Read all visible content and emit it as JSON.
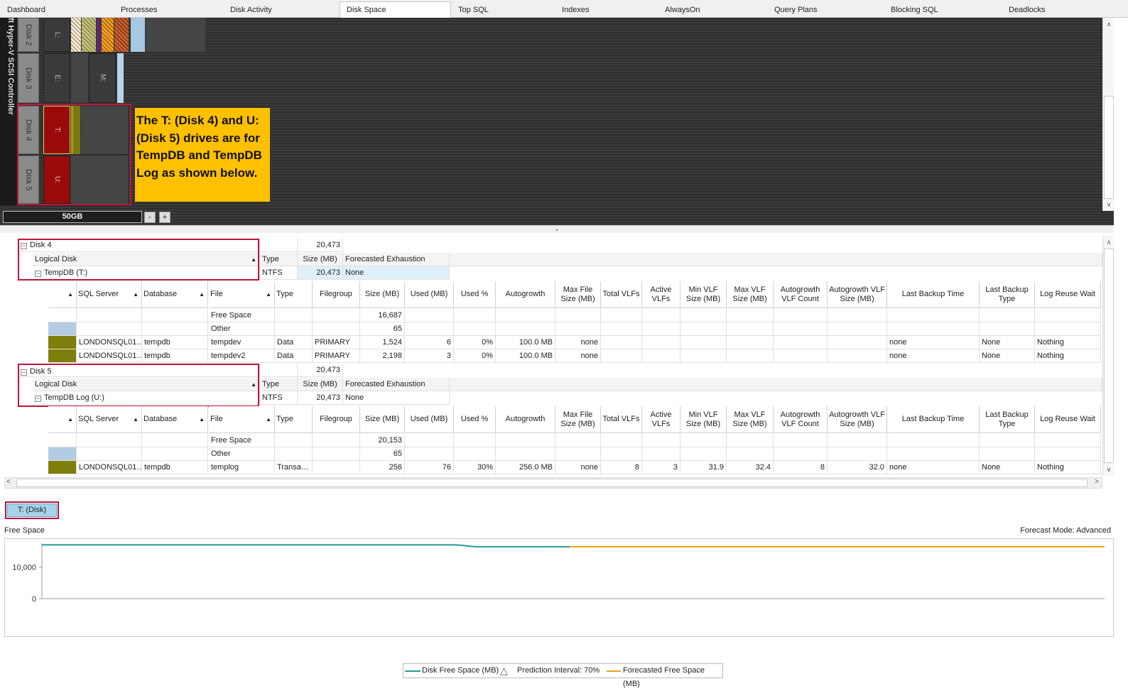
{
  "tabs": [
    "Dashboard",
    "Processes",
    "Disk Activity",
    "Disk Space",
    "Top SQL",
    "Indexes",
    "AlwaysOn",
    "Query Plans",
    "Blocking SQL",
    "Deadlocks"
  ],
  "active_tab": "Disk Space",
  "disk_map": {
    "controller_label": "ft Hyper-V SCSI Controller",
    "disks": [
      "Disk 2",
      "Disk 3",
      "Disk 4",
      "Disk 5"
    ],
    "volumes": {
      "disk2": [
        "L:"
      ],
      "disk3": [
        "E:",
        "M:"
      ],
      "disk4": [
        "T:"
      ],
      "disk5": [
        "U:"
      ]
    },
    "zoom_label": "50GB",
    "zoom_out": "-",
    "zoom_in": "+",
    "callout": "The T: (Disk 4) and U: (Disk 5) drives are for TempDB and TempDB Log as shown below."
  },
  "grid": {
    "disk_headers": [
      "Logical Disk",
      "Type",
      "Size (MB)",
      "Forecasted Exhaustion"
    ],
    "file_headers": [
      "SQL Server",
      "Database",
      "File",
      "Type",
      "Filegroup",
      "Size (MB)",
      "Used (MB)",
      "Used %",
      "Autogrowth",
      "Max File Size (MB)",
      "Total VLFs",
      "Active VLFs",
      "Min VLF Size (MB)",
      "Max VLF Size (MB)",
      "Autogrowth VLF Count",
      "Autogrowth VLF Size (MB)",
      "Last Backup Time",
      "Last Backup Type",
      "Log Reuse Wait"
    ],
    "disk4": {
      "name": "Disk 4",
      "size": "20,473",
      "logical": {
        "name": "TempDB (T:)",
        "type": "NTFS",
        "size": "20,473",
        "forecast": "None"
      },
      "rows": [
        [
          "",
          "",
          "Free Space",
          "",
          "",
          "16,687",
          "",
          "",
          "",
          "",
          "",
          "",
          "",
          "",
          "",
          "",
          "",
          "",
          ""
        ],
        [
          "",
          "",
          "Other",
          "",
          "",
          "65",
          "",
          "",
          "",
          "",
          "",
          "",
          "",
          "",
          "",
          "",
          "",
          "",
          ""
        ],
        [
          "LONDONSQL01…",
          "tempdb",
          "tempdev",
          "Data",
          "PRIMARY",
          "1,524",
          "6",
          "0%",
          "100.0 MB",
          "none",
          "",
          "",
          "",
          "",
          "",
          "",
          "none",
          "None",
          "Nothing"
        ],
        [
          "LONDONSQL01…",
          "tempdb",
          "tempdev2",
          "Data",
          "PRIMARY",
          "2,198",
          "3",
          "0%",
          "100.0 MB",
          "none",
          "",
          "",
          "",
          "",
          "",
          "",
          "none",
          "None",
          "Nothing"
        ]
      ]
    },
    "disk5": {
      "name": "Disk 5",
      "size": "20,473",
      "logical": {
        "name": "TempDB Log (U:)",
        "type": "NTFS",
        "size": "20,473",
        "forecast": "None"
      },
      "rows": [
        [
          "",
          "",
          "Free Space",
          "",
          "",
          "20,153",
          "",
          "",
          "",
          "",
          "",
          "",
          "",
          "",
          "",
          "",
          "",
          "",
          ""
        ],
        [
          "",
          "",
          "Other",
          "",
          "",
          "65",
          "",
          "",
          "",
          "",
          "",
          "",
          "",
          "",
          "",
          "",
          "",
          "",
          ""
        ],
        [
          "LONDONSQL01…",
          "tempdb",
          "templog",
          "Transa…",
          "",
          "256",
          "76",
          "30%",
          "256.0 MB",
          "none",
          "8",
          "3",
          "31.9",
          "32.4",
          "8",
          "32.0",
          "none",
          "None",
          "Nothing"
        ]
      ]
    }
  },
  "chart": {
    "chip": "T: (Disk)",
    "left_label": "Free Space",
    "mode_label": "Forecast Mode: Advanced",
    "legend": [
      "Disk Free Space (MB)",
      "Prediction Interval: 70%",
      "Forecasted Free Space (MB)"
    ],
    "colors": {
      "actual": "#2a9a95",
      "forecast": "#f0a020"
    }
  },
  "chart_data": {
    "type": "line",
    "ylabel": "",
    "yticks": [
      "0",
      "10,000"
    ],
    "ylim": [
      0,
      17500
    ],
    "series": [
      {
        "name": "Disk Free Space (MB)",
        "values": [
          16990,
          16990,
          16990,
          16990,
          16990,
          16990,
          16990,
          16990,
          16990,
          16990,
          16990,
          16990,
          16990,
          16990,
          16990,
          16990,
          16990,
          16990,
          16990,
          16990,
          16990,
          16990,
          16990,
          16990,
          16990,
          16990,
          16990,
          16990,
          16990,
          16990,
          16990,
          16990,
          16990,
          16990,
          16990,
          16990,
          16990,
          16990,
          16990,
          16990,
          16990,
          16990,
          16990,
          16990,
          16990,
          16990,
          16990,
          16990,
          16990,
          16990,
          16990,
          16990,
          16990,
          16990,
          16990,
          16990,
          16990,
          16990,
          16900,
          16600,
          16400,
          16400,
          16400,
          16400,
          16400,
          16400,
          16400,
          16400,
          16400,
          16400,
          16400,
          16400,
          16400,
          16400
        ]
      },
      {
        "name": "Forecasted Free Space (MB)",
        "values": [
          16400,
          16400,
          16400,
          16400,
          16400,
          16400,
          16400,
          16400,
          16400,
          16400,
          16400,
          16400,
          16400,
          16400,
          16400,
          16400,
          16400,
          16400,
          16400,
          16400,
          16400,
          16400,
          16400,
          16400,
          16400,
          16400,
          16400,
          16400,
          16400,
          16400,
          16400,
          16400,
          16400,
          16400,
          16400,
          16400,
          16400,
          16400,
          16400,
          16400,
          16400,
          16400,
          16400,
          16400,
          16400,
          16400,
          16400,
          16400,
          16400,
          16400,
          16400,
          16400,
          16400,
          16400,
          16400,
          16400,
          16400,
          16400,
          16400,
          16400,
          16400,
          16400,
          16400,
          16400,
          16400,
          16400,
          16400,
          16400,
          16400,
          16400,
          16400,
          16400,
          16400,
          16400,
          16400,
          16400,
          16400,
          16400,
          16400,
          16400,
          16400,
          16400
        ]
      }
    ]
  }
}
